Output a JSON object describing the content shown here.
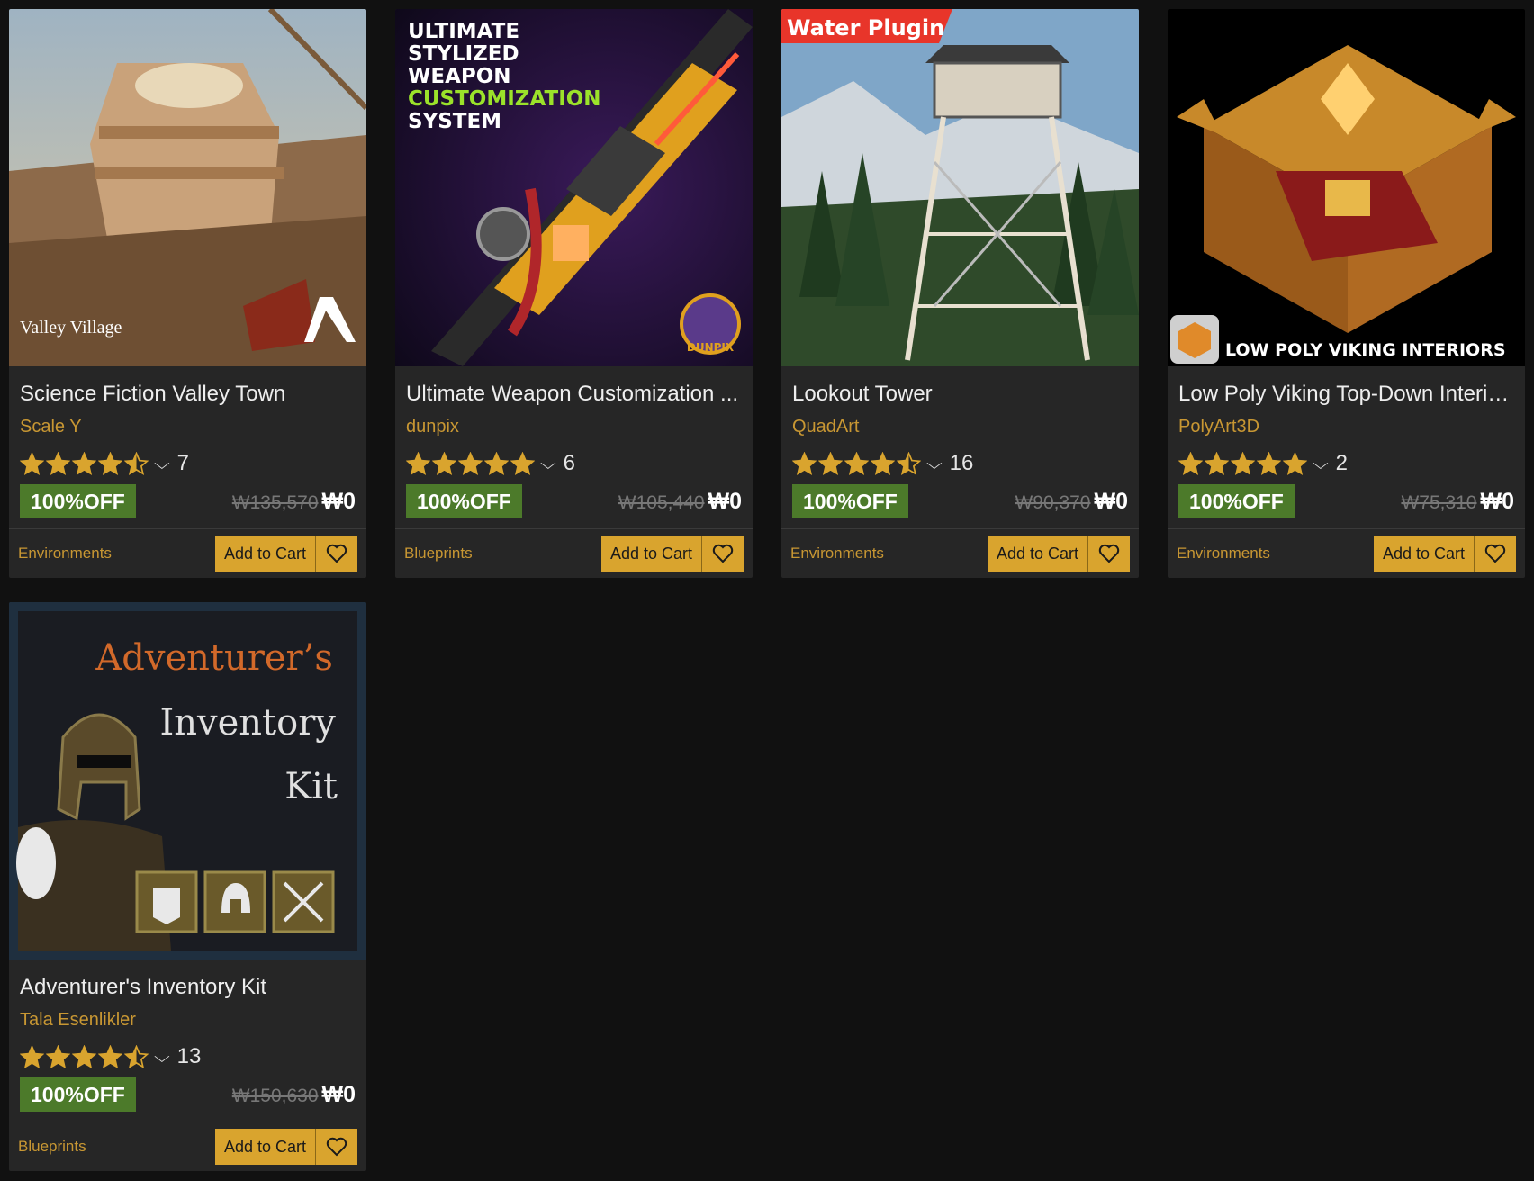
{
  "products": [
    {
      "title": "Science Fiction Valley Town",
      "seller": "Scale Y",
      "rating": 4.5,
      "review_count": "7",
      "discount_label": "100%OFF",
      "original_price": "₩135,570",
      "price": "₩0",
      "category": "Environments",
      "cart_label": "Add to Cart",
      "thumb_caption": "Valley Village",
      "thumb_colors": [
        "#c9a27a",
        "#8d6a4a",
        "#e8d8b8"
      ]
    },
    {
      "title": "Ultimate Weapon Customization ...",
      "seller": "dunpix",
      "rating": 5,
      "review_count": "6",
      "discount_label": "100%OFF",
      "original_price": "₩105,440",
      "price": "₩0",
      "category": "Blueprints",
      "cart_label": "Add to Cart",
      "thumb_caption_lines": [
        "ULTIMATE",
        "STYLIZED",
        "WEAPON",
        "CUSTOMIZATION",
        "SYSTEM"
      ],
      "thumb_logo": "DUNPIX",
      "thumb_colors": [
        "#1a0f2e",
        "#3a1a5a",
        "#e0a01e"
      ]
    },
    {
      "title": "Lookout Tower",
      "seller": "QuadArt",
      "rating": 4.5,
      "review_count": "16",
      "discount_label": "100%OFF",
      "original_price": "₩90,370",
      "price": "₩0",
      "category": "Environments",
      "cart_label": "Add to Cart",
      "thumb_caption": "Water Plugin",
      "thumb_colors": [
        "#7fa6c8",
        "#2f4a2a",
        "#cfd6dc"
      ]
    },
    {
      "title": "Low Poly Viking Top-Down Interiors",
      "seller": "PolyArt3D",
      "rating": 5,
      "review_count": "2",
      "discount_label": "100%OFF",
      "original_price": "₩75,310",
      "price": "₩0",
      "category": "Environments",
      "cart_label": "Add to Cart",
      "thumb_caption": "LOW POLY VIKING INTERIORS",
      "thumb_colors": [
        "#000000",
        "#c8892a",
        "#8a1a1a"
      ]
    },
    {
      "title": "Adventurer's Inventory Kit",
      "seller": "Tala Esenlikler",
      "rating": 4.5,
      "review_count": "13",
      "discount_label": "100%OFF",
      "original_price": "₩150,630",
      "price": "₩0",
      "category": "Blueprints",
      "cart_label": "Add to Cart",
      "thumb_caption_lines": [
        "Adventurer’s",
        "Inventory",
        "Kit"
      ],
      "thumb_colors": [
        "#1a1c22",
        "#d2692a",
        "#e0e0e0"
      ]
    }
  ],
  "colors": {
    "accent": "#d9a42e",
    "seller": "#c89733",
    "discount_bg": "#4c7a2a",
    "card_bg": "#262626",
    "page_bg": "#111111"
  }
}
